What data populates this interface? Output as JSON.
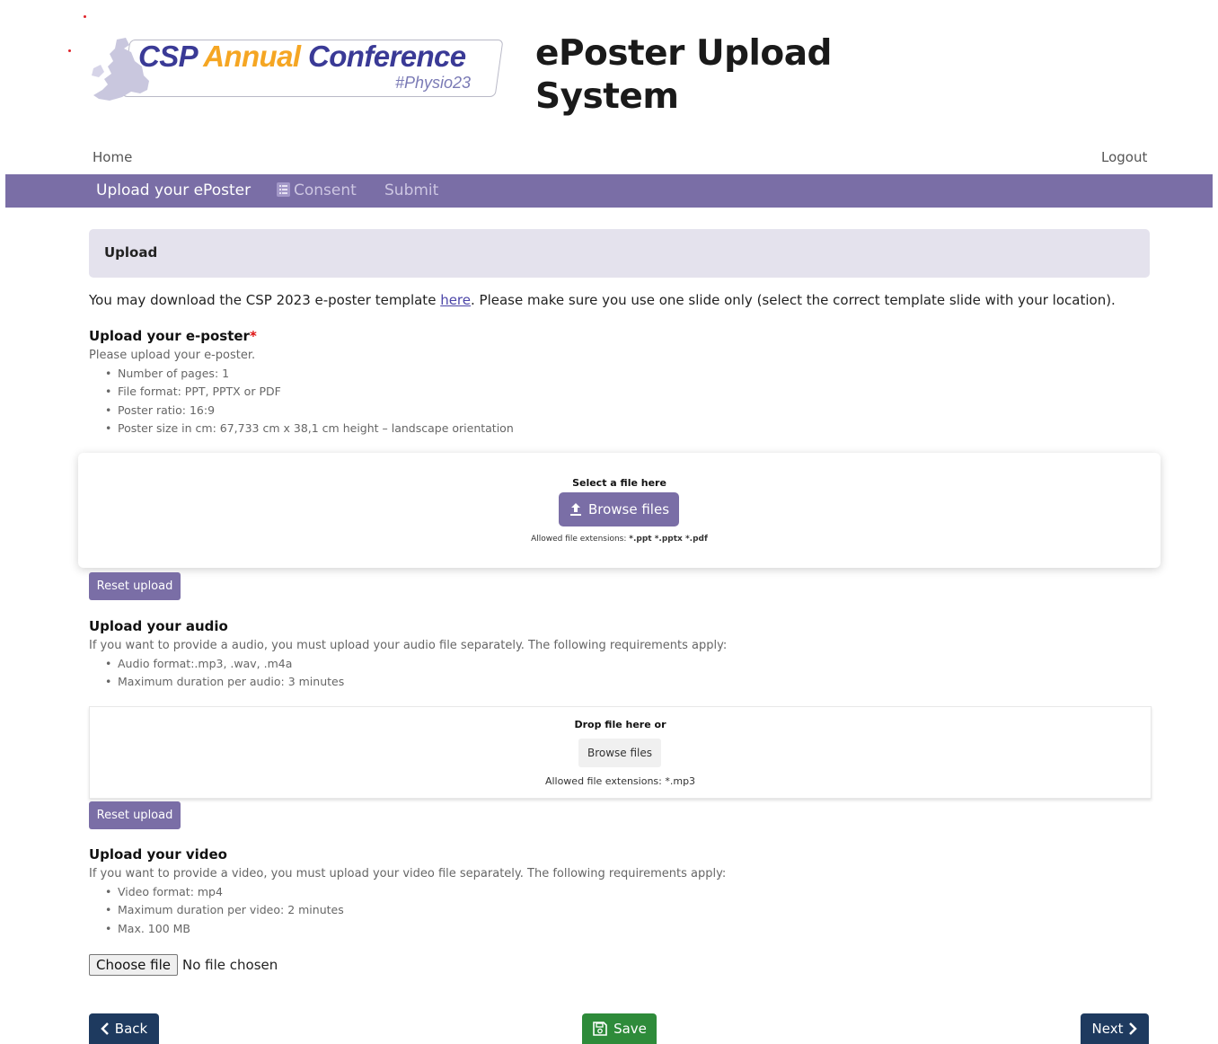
{
  "brand": {
    "logo_main_1": "CSP ",
    "logo_main_2": "Annual ",
    "logo_main_3": "Conference",
    "logo_sub": "#Physio23",
    "site_title_line1": "ePoster Upload",
    "site_title_line2": "System",
    "colors": {
      "primary": "#7a6ea6",
      "dark": "#1e3a5f",
      "green": "#2e8b3a",
      "logo_blue": "#3a3a96",
      "logo_orange": "#f5a623"
    }
  },
  "toplinks": {
    "home": "Home",
    "logout": "Logout"
  },
  "nav": {
    "upload": "Upload your ePoster",
    "consent": "Consent",
    "consent_icon": "list-icon",
    "submit": "Submit"
  },
  "upload_card": {
    "title": "Upload"
  },
  "intro": {
    "before": "You may download the CSP 2023 e-poster template ",
    "link": "here",
    "after": ". Please make sure you use one slide only (select the correct template slide with your location)."
  },
  "eposter": {
    "title": "Upload your e-poster",
    "required_mark": "*",
    "description": "Please upload your e-poster.",
    "requirements": [
      "Number of pages: 1",
      "File format: PPT, PPTX or PDF",
      "Poster ratio: 16:9",
      "Poster size in cm: 67,733 cm x 38,1 cm height – landscape orientation"
    ],
    "dropzone": {
      "heading": "Select a file here",
      "button": "Browse files",
      "button_icon": "upload-icon",
      "allowed_label": "Allowed file extensions: ",
      "allowed_values": "*.ppt *.pptx *.pdf"
    },
    "reset": "Reset upload"
  },
  "audio": {
    "title": "Upload your audio",
    "description": "If you want to provide a audio, you must upload your audio file separately. The following requirements apply:",
    "requirements": [
      "Audio format:.mp3, .wav, .m4a",
      "Maximum duration per audio: 3 minutes"
    ],
    "dropzone": {
      "heading": "Drop file here or",
      "button": "Browse files",
      "allowed": "Allowed file extensions: *.mp3"
    },
    "reset": "Reset upload"
  },
  "video": {
    "title": "Upload your video",
    "description": "If you want to provide a video, you must upload your video file separately. The following requirements apply:",
    "requirements": [
      "Video format: mp4",
      "Maximum duration per video: 2 minutes",
      "Max. 100 MB"
    ],
    "choose_button": "Choose file",
    "file_status": "No file chosen"
  },
  "actions": {
    "back": "Back",
    "save": "Save",
    "next": "Next"
  }
}
